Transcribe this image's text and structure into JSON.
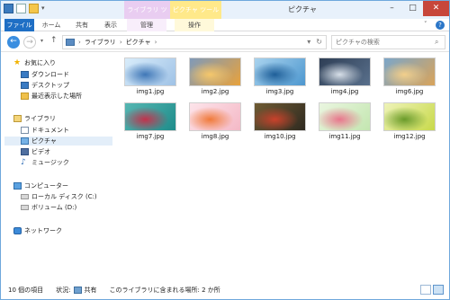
{
  "window": {
    "title": "ピクチャ",
    "buttons": {
      "minimize": "–",
      "maximize": "□",
      "close": "✕"
    }
  },
  "context_tabs": {
    "library_tools": "ライブラリ ツール",
    "picture_tools": "ピクチャ ツール"
  },
  "ribbon_tabs": {
    "file": "ファイル",
    "home": "ホーム",
    "share": "共有",
    "view": "表示",
    "manage": "管理",
    "operations": "操作"
  },
  "address": {
    "crumbs": [
      "ライブラリ",
      "ピクチャ"
    ],
    "separator": "›"
  },
  "search": {
    "placeholder": "ピクチャの検索"
  },
  "nav_pane": {
    "favorites": "お気に入り",
    "downloads": "ダウンロード",
    "desktop": "デスクトップ",
    "recent": "最近表示した場所",
    "libraries": "ライブラリ",
    "documents": "ドキュメント",
    "pictures": "ピクチャ",
    "videos": "ビデオ",
    "music": "ミュージック",
    "computer": "コンピューター",
    "local_disk": "ローカル ディスク (C:)",
    "volume_d": "ボリューム (D:)",
    "network": "ネットワーク"
  },
  "files": [
    {
      "name": "img1.jpg",
      "colors": [
        "#9fc2e6",
        "#3f77b7",
        "#d8ecfa"
      ]
    },
    {
      "name": "img2.jpg",
      "colors": [
        "#e8a23c",
        "#f5c76b",
        "#7f9ab9"
      ]
    },
    {
      "name": "img3.jpg",
      "colors": [
        "#4d97cf",
        "#1f5f99",
        "#a9d3ee"
      ]
    },
    {
      "name": "img4.jpg",
      "colors": [
        "#59708c",
        "#d7dfe8",
        "#2e3e55"
      ]
    },
    {
      "name": "img6.jpg",
      "colors": [
        "#d9a45a",
        "#f2cf8b",
        "#7ba6c9"
      ]
    },
    {
      "name": "img7.jpg",
      "colors": [
        "#1e8c8a",
        "#c2324c",
        "#56b6b2"
      ]
    },
    {
      "name": "img8.jpg",
      "colors": [
        "#f4b8c6",
        "#f07a3a",
        "#fde4ea"
      ]
    },
    {
      "name": "img10.jpg",
      "colors": [
        "#2f2a20",
        "#c9412b",
        "#6f5b34"
      ]
    },
    {
      "name": "img11.jpg",
      "colors": [
        "#c3e6b0",
        "#e9768c",
        "#eaf6e0"
      ]
    },
    {
      "name": "img12.jpg",
      "colors": [
        "#c8d94a",
        "#6a9b2a",
        "#eef3b8"
      ]
    }
  ],
  "status": {
    "count": "10 個の項目",
    "state_label": "状況:",
    "state_value": "共有",
    "location": "このライブラリに含まれる場所: 2 か所"
  }
}
